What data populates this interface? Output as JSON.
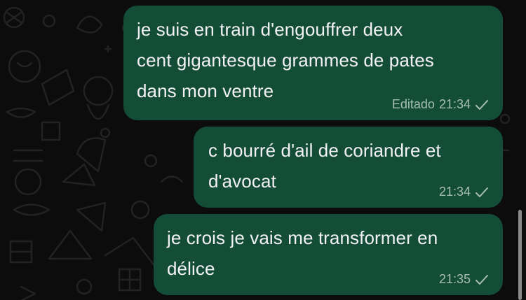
{
  "colors": {
    "background": "#0c0c0c",
    "bubble_outgoing": "#144d37",
    "text": "#f2f2f2",
    "meta_text": "#a7bfb3",
    "wallpaper_doodle": "#1f1f1f"
  },
  "messages": [
    {
      "text": "je suis en train d'engouffrer deux\ncent gigantesque grammes de pates\ndans mon ventre",
      "edited_label": "Editado",
      "time": "21:34",
      "status_icon": "single-check-icon"
    },
    {
      "text": "c bourré d'ail de coriandre et\nd'avocat",
      "time": "21:34",
      "status_icon": "single-check-icon"
    },
    {
      "text": "je crois je vais me transformer en\ndélice",
      "time": "21:35",
      "status_icon": "single-check-icon"
    }
  ]
}
